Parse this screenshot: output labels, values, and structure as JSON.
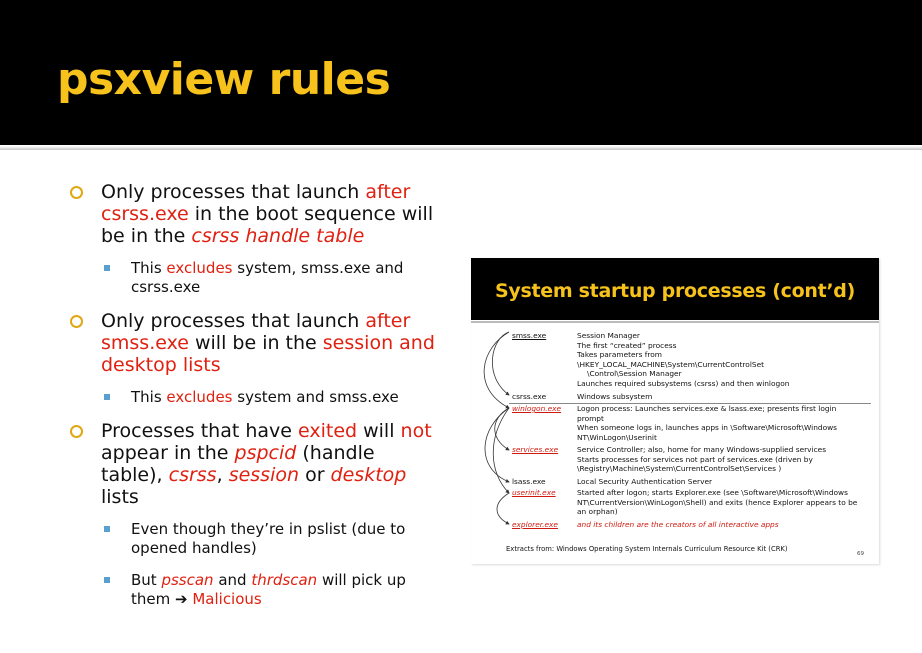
{
  "slide": {
    "title": "psxview rules"
  },
  "bullets": [
    {
      "seg0": "Only processes that launch ",
      "seg1": "after",
      "seg2": " ",
      "seg3": "csrss.exe",
      "seg4": " in the boot sequence will be in the ",
      "seg5": "csrss handle table"
    },
    {
      "sub": {
        "seg0": "This ",
        "seg1": "excludes",
        "seg2": " system, smss.exe and csrss.exe"
      }
    },
    {
      "seg0": "Only processes that launch ",
      "seg1": "after",
      "seg2": " ",
      "seg3": "smss.exe",
      "seg4": " will be in the ",
      "seg5": "session and desktop lists"
    },
    {
      "sub": {
        "seg0": "This ",
        "seg1": "excludes",
        "seg2": " system and smss.exe"
      }
    },
    {
      "seg0": "Processes that have ",
      "seg1": "exited",
      "seg2": " will ",
      "seg3": "not",
      "seg4": " appear in the ",
      "seg5": "pspcid",
      "seg6": " (handle table), ",
      "seg7": "csrss",
      "seg8": ", ",
      "seg9": "session",
      "seg10": " or ",
      "seg11": "desktop",
      "seg12": " lists"
    },
    {
      "sub1": "Even though they’re in pslist (due to opened handles)",
      "sub2": {
        "seg0": "But ",
        "seg1": "psscan",
        "seg2": " and ",
        "seg3": "thrdscan",
        "seg4": " will pick up them ",
        "arrow": "➔",
        "seg5": " Malicious"
      }
    }
  ],
  "embedded_slide": {
    "title": "System startup processes (cont’d)",
    "rows": [
      {
        "name": "smss.exe",
        "lines": [
          "Session Manager",
          "The first “created” process",
          "Takes parameters from",
          "\\HKEY_LOCAL_MACHINE\\System\\CurrentControlSet",
          "    \\Control\\Session Manager",
          "Launches required subsystems (csrss) and then winlogon"
        ]
      },
      {
        "name": "csrss.exe",
        "lines": [
          "Windows subsystem"
        ]
      },
      {
        "name": "winlogon.exe",
        "lines": [
          "Logon process: Launches services.exe & lsass.exe; presents first login",
          "prompt",
          "When someone logs in, launches apps in \\Software\\Microsoft\\Windows",
          "NT\\WinLogon\\Userinit"
        ]
      },
      {
        "name": "services.exe",
        "lines": [
          "Service Controller; also, home for many Windows-supplied services",
          "Starts processes for services not part of services.exe (driven by",
          "\\Registry\\Machine\\System\\CurrentControlSet\\Services )"
        ]
      },
      {
        "name": "lsass.exe",
        "lines": [
          "Local Security Authentication Server"
        ]
      },
      {
        "name": "userinit.exe",
        "lines": [
          "Started after logon; starts Explorer.exe (see \\Software\\Microsoft\\Windows",
          "NT\\CurrentVersion\\WinLogon\\Shell) and exits (hence Explorer appears to be",
          "an orphan)"
        ]
      },
      {
        "name": "explorer.exe",
        "lines": [
          "and its children are the creators of all interactive apps"
        ]
      }
    ],
    "extract": "Extracts from: Windows Operating System Internals Curriculum Resource Kit (CRK)",
    "page": "69"
  },
  "colors": {
    "title": "#f6c21b",
    "accent_red": "#e02010",
    "ring_bullet": "#e0a711",
    "square_bullet": "#5aa0cf"
  }
}
